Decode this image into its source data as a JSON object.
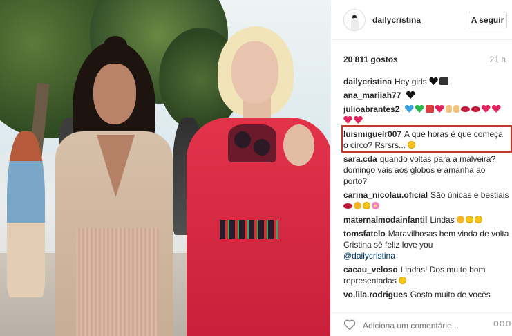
{
  "header": {
    "username": "dailycristina",
    "follow_label": "A seguir"
  },
  "stats": {
    "likes": "20 811 gostos",
    "time": "21 h"
  },
  "comments": [
    {
      "user": "dailycristina",
      "text": "Hey girls",
      "emojis": [
        "heart-b",
        "cam"
      ]
    },
    {
      "user": "ana_mariiah77",
      "text": "",
      "emojis": [
        "heart-b"
      ]
    },
    {
      "user": "julioabrantes2",
      "text": "",
      "emojis": [
        "heart-bl",
        "heart-g",
        "gift",
        "heart-r",
        "hand",
        "hand",
        "lips",
        "lips",
        "heart-r",
        "heart-r",
        "heart-r",
        "heart-r"
      ]
    },
    {
      "user": "luismiguelr007",
      "text": "A que horas é que começa o circo? Rsrsrs...",
      "emojis": [
        "smile"
      ]
    },
    {
      "user": "sara.cda",
      "text": "quando voltas para a malveira? domingo vais aos globos e amanha ao porto?",
      "emojis": []
    },
    {
      "user": "carina_nicolau.oficial",
      "text": "São únicas e bestiais",
      "emojis": [
        "lips",
        "kiss",
        "smile",
        "flower"
      ]
    },
    {
      "user": "maternalmodainfantil",
      "text": "Lindas",
      "emojis": [
        "kiss",
        "smile",
        "smile"
      ]
    },
    {
      "user": "tomsfatelo",
      "text": "Maravilhosas bem vinda de volta Cristina sê feliz love you",
      "mention": "@dailycristina",
      "emojis": []
    },
    {
      "user": "cacau_veloso",
      "text": "Lindas! Dos muito bom representadas",
      "emojis": [
        "smile"
      ]
    },
    {
      "user": "vo.lila.rodrigues",
      "text": "Gosto muito de vocês",
      "emojis": []
    }
  ],
  "footer": {
    "add_comment_placeholder": "Adiciona um comentário...",
    "more_label": "ooo"
  },
  "icons": {
    "like": "heart-outline-icon",
    "more": "more-options-icon"
  },
  "colors": {
    "highlight_border": "#c0392b",
    "mention": "#003569"
  }
}
